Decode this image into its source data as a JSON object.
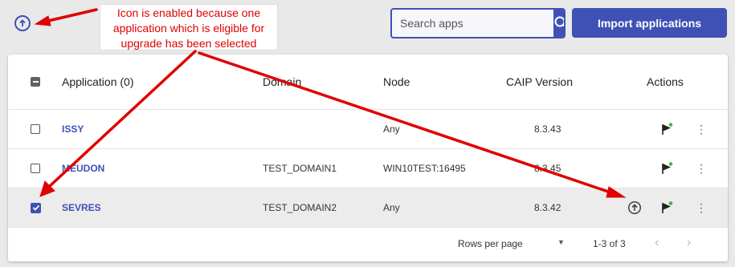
{
  "search": {
    "placeholder": "Search apps"
  },
  "toolbar": {
    "import_label": "Import applications"
  },
  "table": {
    "columns": {
      "application": "Application (0)",
      "domain": "Domain",
      "node": "Node",
      "caip": "CAIP Version",
      "actions": "Actions"
    },
    "rows": [
      {
        "name": "ISSY",
        "domain": "",
        "node": "Any",
        "caip": "8.3.43",
        "checked": false
      },
      {
        "name": "MEUDON",
        "domain": "TEST_DOMAIN1",
        "node": "WIN10TEST:16495",
        "caip": "8.3.45",
        "checked": false
      },
      {
        "name": "SEVRES",
        "domain": "TEST_DOMAIN2",
        "node": "Any",
        "caip": "8.3.42",
        "checked": true
      }
    ]
  },
  "pagination": {
    "rows_per_page_label": "Rows per page",
    "range": "1-3 of 3"
  },
  "annotation": {
    "lines": [
      "Icon is enabled because one",
      "application which is eligible for",
      "upgrade has been selected"
    ]
  },
  "colors": {
    "accent": "#3f51b5",
    "annotation": "#e00000",
    "flag_status": "#4caf50"
  },
  "icons": {
    "upgrade": "upgrade-icon",
    "search": "search-icon",
    "flag": "flag-icon",
    "more": "more-vertical-icon"
  }
}
